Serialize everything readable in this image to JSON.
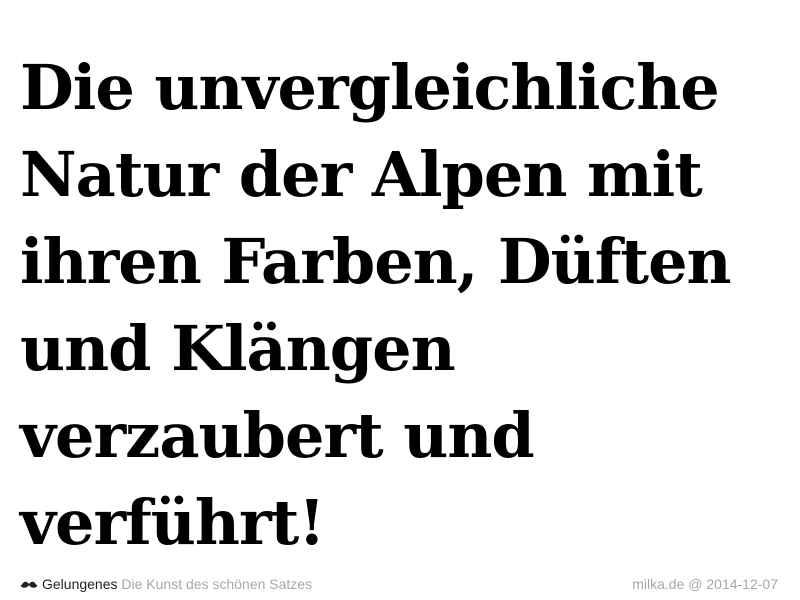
{
  "quote": {
    "lines": [
      "Die unvergleichliche",
      "Natur der Alpen mit",
      "ihren Farben, Düften",
      "und Klängen",
      "verzaubert und",
      "verführt!"
    ]
  },
  "footer": {
    "icon": "mustache-icon",
    "brand": "Gelungenes",
    "tagline": "Die Kunst des schönen Satzes",
    "source": "milka.de",
    "separator": "@",
    "date": "2014-12-07"
  }
}
